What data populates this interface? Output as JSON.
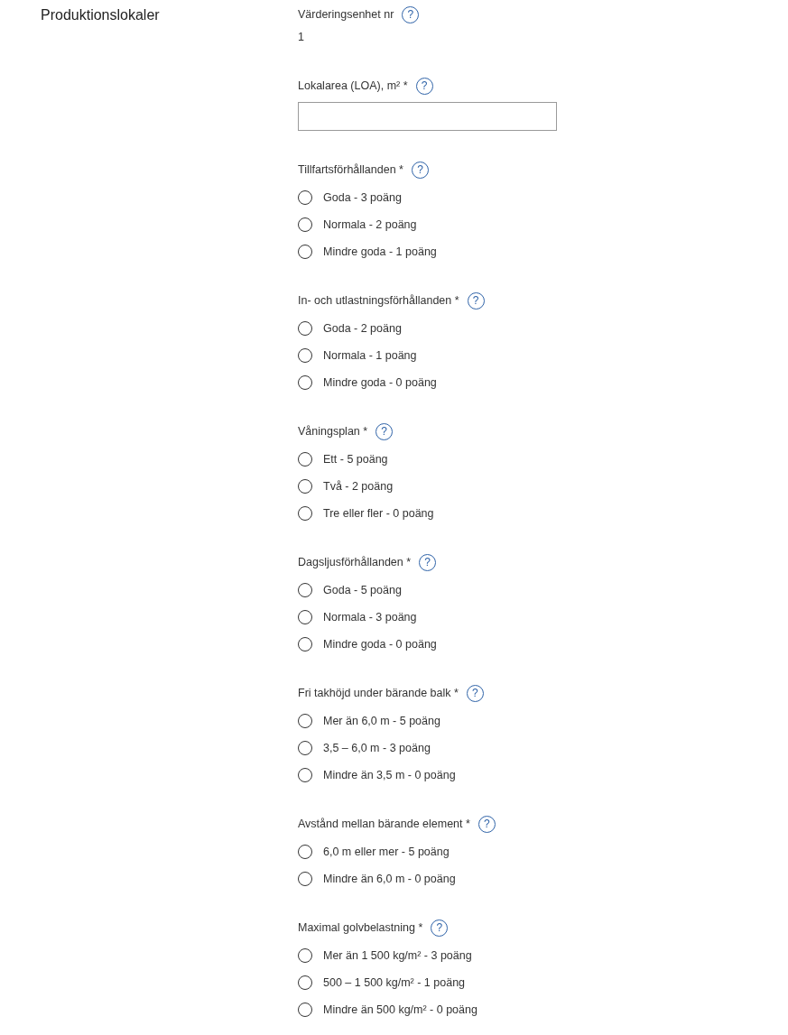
{
  "section_title": "Produktionslokaler",
  "unit": {
    "label": "Värderingsenhet nr",
    "help": "?",
    "value": "1"
  },
  "area": {
    "label": "Lokalarea (LOA), m² *",
    "help": "?"
  },
  "groups": [
    {
      "label": "Tillfartsförhållanden *",
      "help": "?",
      "options": [
        {
          "label": "Goda - 3 poäng",
          "checked": false
        },
        {
          "label": "Normala - 2 poäng",
          "checked": false
        },
        {
          "label": "Mindre goda - 1 poäng",
          "checked": false
        }
      ]
    },
    {
      "label": "In- och utlastningsförhållanden *",
      "help": "?",
      "options": [
        {
          "label": "Goda - 2 poäng",
          "checked": false
        },
        {
          "label": "Normala - 1 poäng",
          "checked": false
        },
        {
          "label": "Mindre goda - 0 poäng",
          "checked": false
        }
      ]
    },
    {
      "label": "Våningsplan *",
      "help": "?",
      "options": [
        {
          "label": "Ett - 5 poäng",
          "checked": false
        },
        {
          "label": "Två - 2 poäng",
          "checked": false
        },
        {
          "label": "Tre eller fler - 0 poäng",
          "checked": false
        }
      ]
    },
    {
      "label": "Dagsljusförhållanden *",
      "help": "?",
      "options": [
        {
          "label": "Goda - 5 poäng",
          "checked": false
        },
        {
          "label": "Normala - 3 poäng",
          "checked": false
        },
        {
          "label": "Mindre goda - 0 poäng",
          "checked": false
        }
      ]
    },
    {
      "label": "Fri takhöjd under bärande balk *",
      "help": "?",
      "options": [
        {
          "label": "Mer än 6,0 m - 5 poäng",
          "checked": false
        },
        {
          "label": "3,5 – 6,0 m - 3 poäng",
          "checked": false
        },
        {
          "label": "Mindre än 3,5 m - 0 poäng",
          "checked": false
        }
      ]
    },
    {
      "label": "Avstånd mellan bärande element *",
      "help": "?",
      "options": [
        {
          "label": "6,0 m eller mer - 5 poäng",
          "checked": false
        },
        {
          "label": "Mindre än 6,0 m - 0 poäng",
          "checked": false
        }
      ]
    },
    {
      "label": "Maximal golvbelastning *",
      "help": "?",
      "options": [
        {
          "label": "Mer än 1 500 kg/m² - 3 poäng",
          "checked": false
        },
        {
          "label": "500 – 1 500 kg/m² - 1 poäng",
          "checked": false
        },
        {
          "label": "Mindre än 500 kg/m² - 0 poäng",
          "checked": false
        }
      ]
    }
  ]
}
